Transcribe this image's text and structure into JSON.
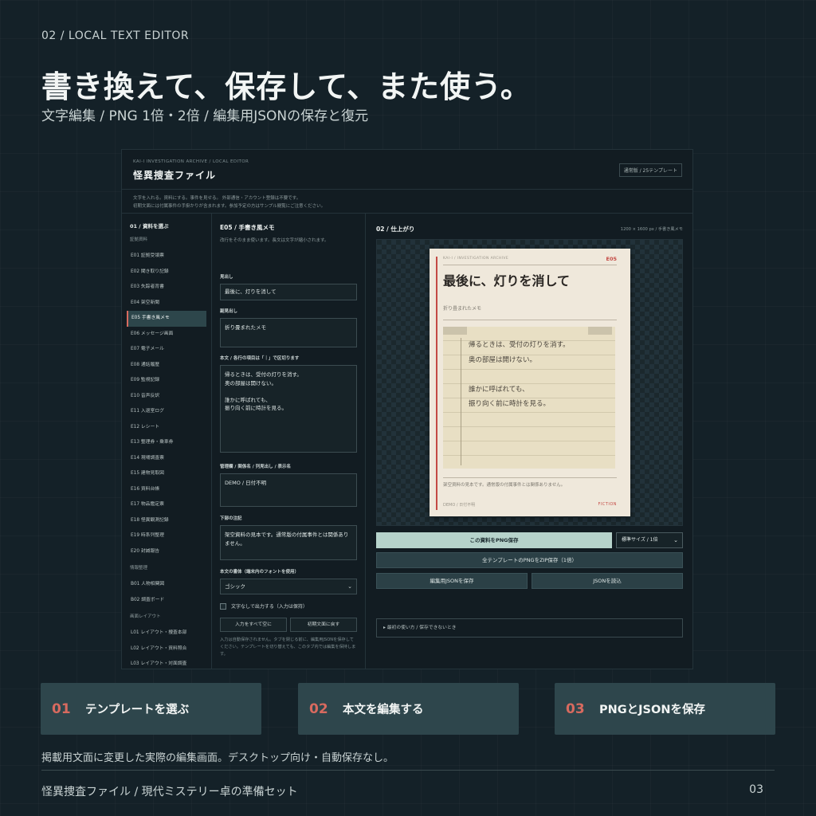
{
  "page": {
    "kicker": "02 / LOCAL TEXT EDITOR",
    "title": "書き換えて、保存して、また使う。",
    "subtitle": "文字編集 / PNG 1倍・2倍 / 編集用JSONの保存と復元",
    "caption": "掲載用文面に変更した実際の編集画面。デスクトップ向け・自動保存なし。",
    "footer_left": "怪異捜査ファイル / 現代ミステリー卓の準備セット",
    "footer_right": "03"
  },
  "app": {
    "kicker": "KAI-I INVESTIGATION ARCHIVE / LOCAL EDITOR",
    "title": "怪異捜査ファイル",
    "edition_badge": "通常版 / 25テンプレート",
    "notice_line1": "文字を入れる。資料にする。事件を見せる。 外部通信・アカウント登録は不要です。",
    "notice_line2": "初期文面には付属事件の手掛かりが含まれます。参加予定の方はサンプル閲覧にご注意ください。"
  },
  "sidebar": {
    "heading": "01 / 資料を選ぶ",
    "group1_label": "証拠資料",
    "group1": [
      "E01 証拠受領票",
      "E02 聞き取り記録",
      "E03 失踪者背書",
      "E04 架空新聞",
      "E05 手書き風メモ",
      "E06 メッセージ画面",
      "E07 電子メール",
      "E08 通話履歴",
      "E09 監視記録",
      "E10 音声反訳",
      "E11 入退室ログ",
      "E12 レシート",
      "E13 整理券・乗車券",
      "E14 現場調査票",
      "E15 建物見取図",
      "E16 資料台帳",
      "E17 物品鑑定票",
      "E18 怪異観測記録",
      "E19 時系列整理",
      "E20 封緘報告"
    ],
    "group2_label": "情報整理",
    "group2": [
      "B01 人物相関図",
      "B02 調査ボード"
    ],
    "group3_label": "画面レイアウト",
    "group3": [
      "L01 レイアウト・捜査本部",
      "L02 レイアウト・資料照合",
      "L03 レイアウト・対面調査"
    ]
  },
  "editor": {
    "title": "E05 / 手書き風メモ",
    "note": "改行をそのまま使います。長文は文字が縮小されます。",
    "heading_label": "見出し",
    "heading_value": "最後に、灯りを消して",
    "subheading_label": "副見出し",
    "subheading_value": "折り畳まれたメモ",
    "body_label": "本文 / 各行の項目は「｜」で区切ります",
    "body_value": "帰るときは、受付の灯りを消す。\n奥の部屋は開けない。\n\n誰かに呼ばれても、\n振り向く前に時計を見る。",
    "admin_label": "管理欄 / 関係名 / 列見出し / 表示名",
    "admin_value": "DEMO / 日付不明",
    "footer_note_label": "下部の注記",
    "footer_note_value": "架空資料の見本です。通常版の付属事件とは関係ありません。",
    "font_label": "本文の書体（端末内のフォントを使用）",
    "font_value": "ゴシック",
    "no_text_label": "文字なしで出力する（入力は保持）",
    "clear_button": "入力をすべて空に",
    "reset_button": "初期文面に戻す",
    "fine_print": "入力は自動保存されません。タブを閉じる前に、編集用JSONを保存してください。テンプレートを切り替えても、このタブ内では編集を保持します。"
  },
  "preview": {
    "title": "02 / 仕上がり",
    "meta": "1200 × 1600 px / 手書き風メモ",
    "paper_kicker": "KAI-I / INVESTIGATION ARCHIVE",
    "paper_code": "E05",
    "paper_title": "最後に、灯りを消して",
    "paper_sub": "折り畳まれたメモ",
    "memo_text": "帰るときは、受付の灯りを消す。\n奥の部屋は開けない。\n\n誰かに呼ばれても、\n振り向く前に時計を見る。",
    "paper_note": "架空資料の見本です。通常版の付属事件とは関係ありません。",
    "paper_foot_left": "DEMO / 日付不明",
    "paper_foot_right": "FICTION"
  },
  "actions": {
    "save_png": "この資料をPNG保存",
    "size_select": "標準サイズ / 1倍",
    "save_all_zip": "全テンプレートのPNGをZIP保存（1倍）",
    "save_json": "編集用JSONを保存",
    "load_json": "JSONを読込",
    "help_details": "▸ 最初の使い方 / 保存できないとき"
  },
  "steps": [
    {
      "num": "01",
      "label": "テンプレートを選ぶ"
    },
    {
      "num": "02",
      "label": "本文を編集する"
    },
    {
      "num": "03",
      "label": "PNGとJSONを保存"
    }
  ],
  "colors": {
    "background": "#142128",
    "accent_red": "#d86a5f",
    "primary_button": "#b6d3cb",
    "step_card": "#2e464c",
    "paper": "#efe8db"
  }
}
